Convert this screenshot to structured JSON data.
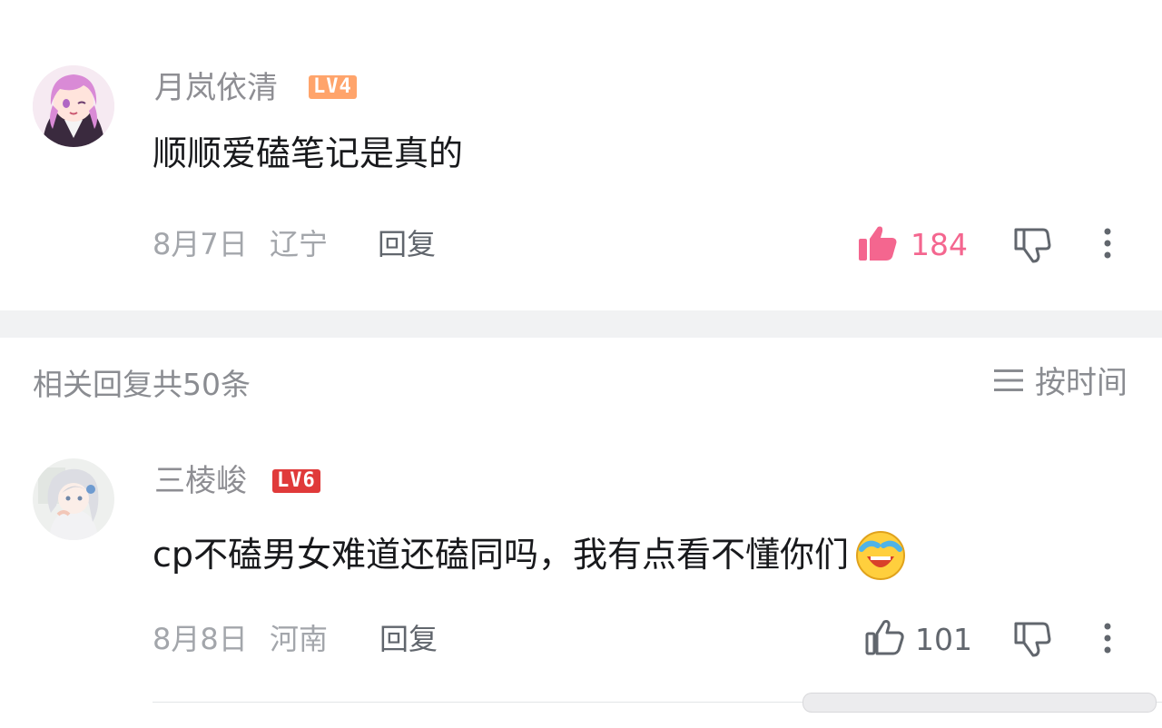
{
  "comment": {
    "username": "月岚依清",
    "level": "LV4",
    "level_color": "#ffa46b",
    "text": "顺顺爱磕笔记是真的",
    "date": "8月7日",
    "location": "辽宁",
    "reply_label": "回复",
    "likes": "184",
    "liked": true,
    "accent_color": "#f4668f"
  },
  "replies_header": {
    "label": "相关回复共50条",
    "sort_label": "按时间"
  },
  "reply": {
    "username": "三棱峻",
    "level": "LV6",
    "level_color": "#e03a3a",
    "text": "cp不磕男女难道还磕同吗，我有点看不懂你们",
    "emoji": "laughing-crying-emoji",
    "date": "8月8日",
    "location": "河南",
    "reply_label": "回复",
    "likes": "101",
    "liked": false
  },
  "icons": {
    "like": "thumbs-up-icon",
    "dislike": "thumbs-down-icon",
    "more": "more-vertical-icon",
    "sort": "sort-lines-icon"
  }
}
